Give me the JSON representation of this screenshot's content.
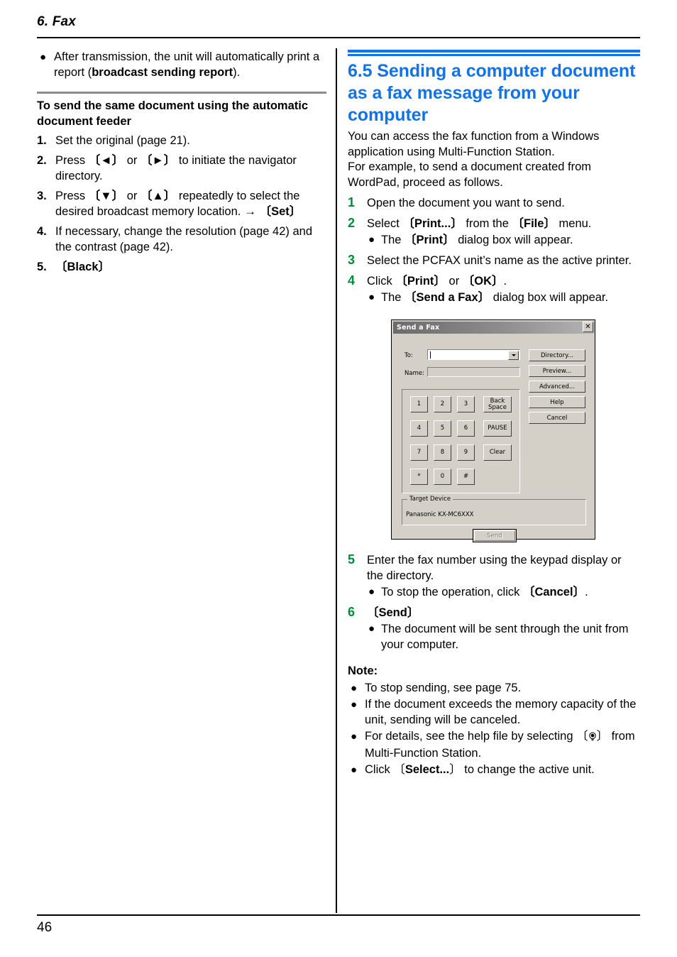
{
  "page": {
    "chapter_head": "6. Fax",
    "page_number": "46"
  },
  "left_column": {
    "intro_bullet": {
      "bullet": "●",
      "text_before": "After transmission, the unit will automatically print a report (",
      "text_bold": "broadcast sending report",
      "text_after": ")."
    },
    "subheading": "To send the same document using the automatic document feeder",
    "steps": [
      {
        "num": "1.",
        "text": "Set the original (page 21)."
      },
      {
        "num": "2.",
        "text": "Press 〔◄〕 or 〔►〕 to initiate the navigator directory."
      },
      {
        "num": "3.",
        "text": "Press 〔▼〕 or 〔▲〕 repeatedly to select the desired broadcast memory location. → 〔Set〕"
      },
      {
        "num": "4.",
        "text": "If necessary, change the resolution (page 42) and the contrast (page 42)."
      },
      {
        "num": "5.",
        "text": "〔Black〕"
      }
    ]
  },
  "right_column": {
    "section_heading": "6.5 Sending a computer document as a fax message from your computer",
    "section_heading_color": "#1272e8",
    "intro_paragraph_lines": [
      "You can access the fax function from a Windows",
      "application using Multi-Function Station.",
      "For example, to send a document created from",
      "WordPad, proceed as follows."
    ],
    "step_number_color": "#008a3c",
    "steps": [
      {
        "num": "1",
        "text": "Open the document you want to send.",
        "subs": []
      },
      {
        "num": "2",
        "text": "Select 〔Print...〕 from the 〔File〕 menu.",
        "subs": [
          "The 〔Print〕 dialog box will appear."
        ]
      },
      {
        "num": "3",
        "text": "Select the PCFAX unit’s name as the active printer.",
        "subs": []
      },
      {
        "num": "4",
        "text": "Click 〔Print〕 or 〔OK〕.",
        "subs": [
          "The 〔Send a Fax〕 dialog box will appear."
        ]
      }
    ],
    "steps_after_figure": [
      {
        "num": "5",
        "text": "Enter the fax number using the keypad display or the directory.",
        "subs": [
          "To stop the operation, click 〔Cancel〕."
        ]
      },
      {
        "num": "6",
        "text": "〔Send〕",
        "subs": [
          "The document will be sent through the unit from your computer."
        ]
      }
    ],
    "note": {
      "label": "Note:",
      "items": [
        "To stop sending, see page 75.",
        "If the document exceeds the memory capacity of the unit, sending will be canceled.",
        "For details, see the help file by selecting 〔 〕 from Multi-Function Station.",
        "Click 〔Select...〕 to change the active unit."
      ],
      "help_icon_name": "lightbulb-icon"
    },
    "bullet_glyph": "●"
  },
  "dialog": {
    "title": "Send a Fax",
    "close_label": "✕",
    "to_label": "To:",
    "to_value": "",
    "name_label": "Name:",
    "name_value": "",
    "keypad": {
      "keys": [
        "1",
        "2",
        "3",
        "4",
        "5",
        "6",
        "7",
        "8",
        "9",
        "*",
        "0",
        "#"
      ],
      "fn_keys": [
        "Back Space",
        "PAUSE",
        "Clear"
      ]
    },
    "side_buttons": [
      {
        "label": "Directory...",
        "accel": "D"
      },
      {
        "label": "Preview...",
        "accel": "P"
      },
      {
        "label": "Advanced...",
        "accel": "v"
      },
      {
        "label": "Help",
        "accel": "H"
      },
      {
        "label": "Cancel",
        "accel": ""
      }
    ],
    "target_device": {
      "legend": "Target Device",
      "value": "Panasonic KX-MC6XXX"
    },
    "send_button": {
      "label": "Send",
      "enabled": false
    }
  }
}
